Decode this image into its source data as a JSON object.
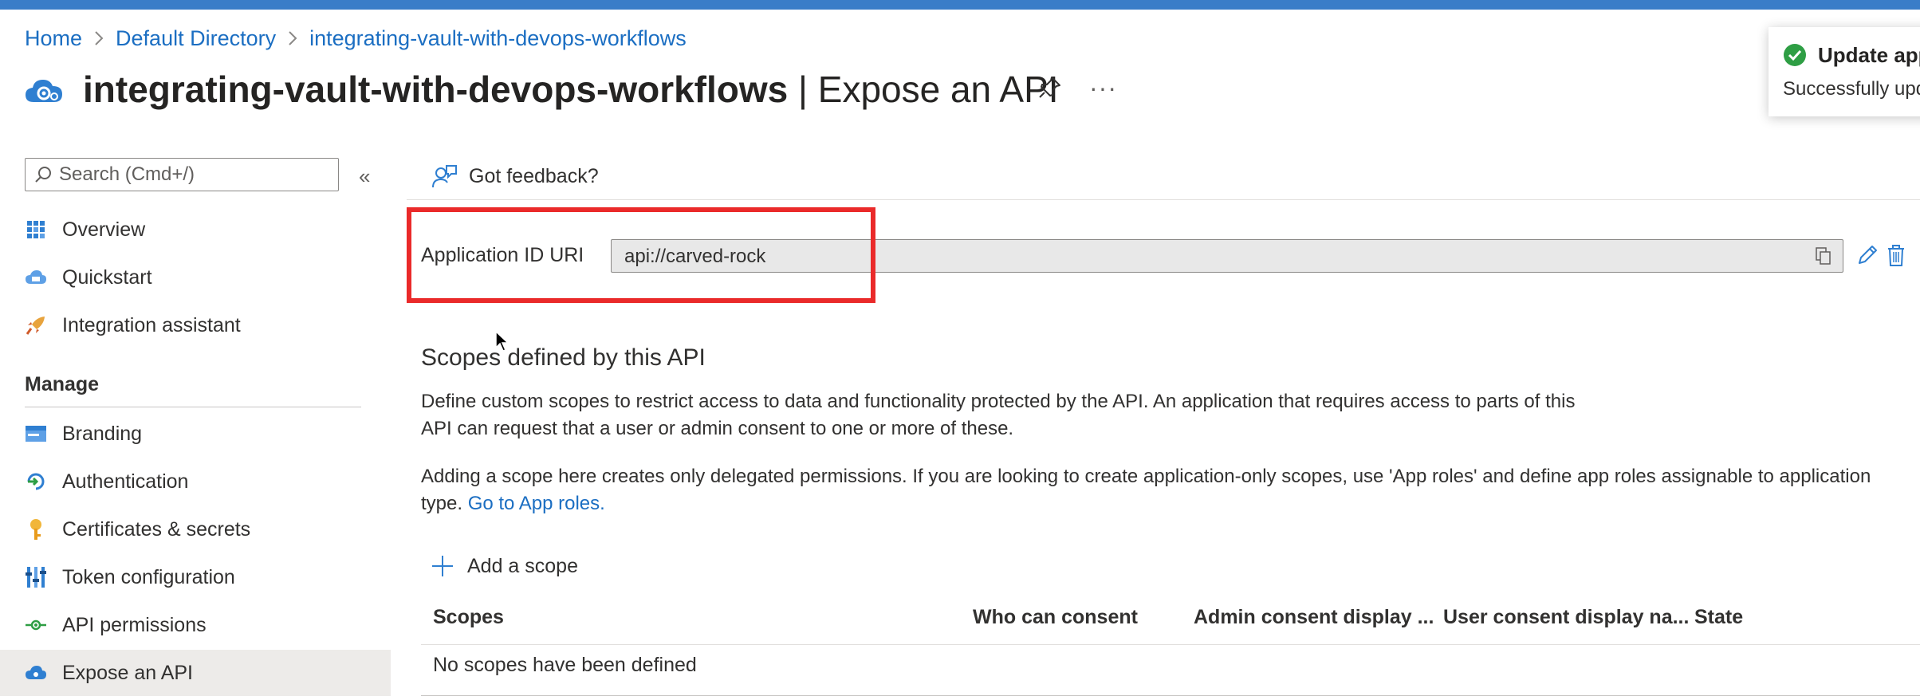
{
  "breadcrumb": {
    "items": [
      "Home",
      "Default Directory",
      "integrating-vault-with-devops-workflows"
    ]
  },
  "header": {
    "app_name": "integrating-vault-with-devops-workflows",
    "separator": " | ",
    "page_name": "Expose an API",
    "more_label": "···"
  },
  "toast": {
    "title": "Update app",
    "message": "Successfully upd"
  },
  "sidebar": {
    "search_placeholder": "Search (Cmd+/)",
    "collapse_label": "«",
    "items": [
      {
        "label": "Overview",
        "icon": "grid-icon"
      },
      {
        "label": "Quickstart",
        "icon": "cloud-icon"
      },
      {
        "label": "Integration assistant",
        "icon": "rocket-icon"
      }
    ],
    "manage_heading": "Manage",
    "manage_items": [
      {
        "label": "Branding",
        "icon": "branding-icon"
      },
      {
        "label": "Authentication",
        "icon": "authentication-icon"
      },
      {
        "label": "Certificates & secrets",
        "icon": "key-icon"
      },
      {
        "label": "Token configuration",
        "icon": "token-icon"
      },
      {
        "label": "API permissions",
        "icon": "api-permissions-icon"
      },
      {
        "label": "Expose an API",
        "icon": "cloud-icon",
        "active": true
      }
    ]
  },
  "main": {
    "feedback_label": "Got feedback?",
    "app_id_label": "Application ID URI",
    "app_id_value": "api://carved-rock",
    "scopes_heading": "Scopes defined by this API",
    "paragraph1_line1": "Define custom scopes to restrict access to data and functionality protected by the API. An application that requires access to parts of this",
    "paragraph1_line2": "API can request that a user or admin consent to one or more of these.",
    "paragraph2_line1": "Adding a scope here creates only delegated permissions. If you are looking to create application-only scopes, use 'App roles' and define app roles assignable to application",
    "paragraph2_line2_prefix": "type. ",
    "paragraph2_link": "Go to App roles.",
    "add_scope_label": "Add a scope",
    "table": {
      "columns": [
        "Scopes",
        "Who can consent",
        "Admin consent display ...",
        "User consent display na...",
        "State"
      ],
      "empty_message": "No scopes have been defined"
    }
  },
  "colors": {
    "accent": "#1b6ec2",
    "highlight": "#ea2a2a",
    "success": "#2e9e44"
  }
}
